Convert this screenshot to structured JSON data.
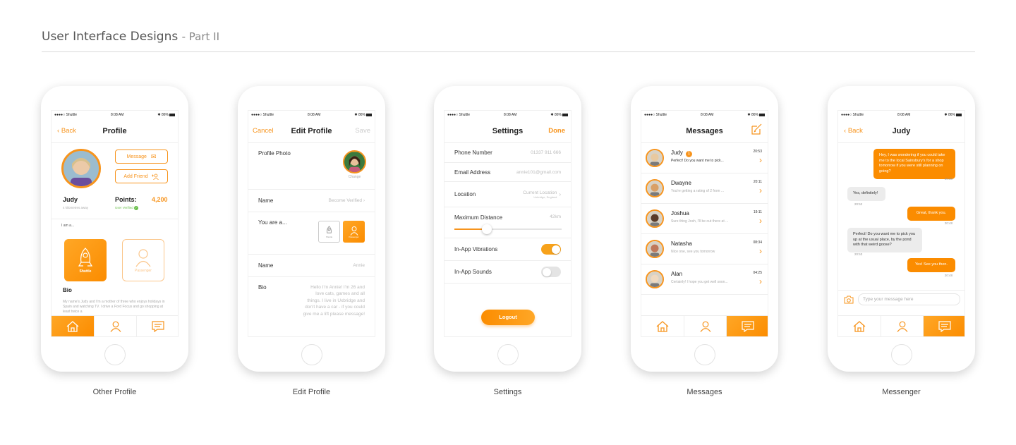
{
  "header": {
    "title": "User Interface Designs",
    "subtitle": "- Part II"
  },
  "status_bar": {
    "carrier": "●●●●○ Shuttle",
    "time": "8:08 AM",
    "battery": "✱ 86%"
  },
  "screens": {
    "other_profile": {
      "caption": "Other Profile",
      "back": "Back",
      "title": "Profile",
      "message_btn": "Message",
      "add_friend_btn": "Add Friend",
      "name": "Judy",
      "distance": "4 kilometres away",
      "points_label": "Points:",
      "points_value": "4,200",
      "verified": "User Verified",
      "role_prompt": "I am a...",
      "role_shuttle": "Shuttle",
      "role_passenger": "Passenger",
      "bio_label": "Bio",
      "bio_text": "My name's Judy and I'm a mother of three who enjoys holidays in Spain and watching TV. I drive a Ford Focus and go shopping at least twice a"
    },
    "edit_profile": {
      "caption": "Edit Profile",
      "cancel": "Cancel",
      "title": "Edit Profile",
      "save": "Save",
      "photo_label": "Profile Photo",
      "change": "Change",
      "name_label": "Name",
      "name_value": "Become Verified",
      "role_prompt": "You are a...",
      "role_shuttle": "Shuttle",
      "role_passenger": "Passenger",
      "name2_label": "Name",
      "name2_value": "Annie",
      "bio_label": "Bio",
      "bio_text": "Hello I'm Annie! I'm 26 and love cats, games and all things. I live in Uxbridge and don't have a car - if you could give me a lift please message!"
    },
    "settings": {
      "caption": "Settings",
      "title": "Settings",
      "done": "Done",
      "phone_label": "Phone Number",
      "phone_value": "01337 911 666",
      "email_label": "Email Address",
      "email_value": "annie101@gmail.com",
      "location_label": "Location",
      "location_value": "Current Location",
      "location_sub": "Uxbridge, England",
      "distance_label": "Maximum Distance",
      "distance_value": "42km",
      "distance_fraction": 0.3,
      "vibrations_label": "In-App Vibrations",
      "vibrations_on": true,
      "sounds_label": "In-App Sounds",
      "sounds_on": false,
      "logout": "Logout"
    },
    "messages": {
      "caption": "Messages",
      "title": "Messages",
      "items": [
        {
          "name": "Judy",
          "badge": "1",
          "time": "20:53",
          "preview": "Perfect! Do you want me to pick...",
          "face": "#e8c9a0"
        },
        {
          "name": "Dwayne",
          "badge": "",
          "time": "20:11",
          "preview": "You're getting a rating of 2 from ...",
          "face": "#d9a066"
        },
        {
          "name": "Joshua",
          "badge": "",
          "time": "19:11",
          "preview": "Sure thing Josh, I'll be out there at ...",
          "face": "#5a3b28"
        },
        {
          "name": "Natasha",
          "badge": "",
          "time": "08:34",
          "preview": "Nice one, see you tomorrow",
          "face": "#c0785a"
        },
        {
          "name": "Alan",
          "badge": "",
          "time": "04:25",
          "preview": "Certainly! I hope you get well soon...",
          "face": "#efd9c0"
        }
      ]
    },
    "messenger": {
      "caption": "Messenger",
      "back": "Back",
      "title": "Judy",
      "input_placeholder": "Type your message here",
      "bubbles": [
        {
          "dir": "out",
          "text": "Hey, I was wondering if you could take me to the local Sainsbury's for a shop tomorrow if you were still planning on going?",
          "time": "20:38"
        },
        {
          "dir": "in",
          "text": "Yes, definitely!",
          "time": "20:52"
        },
        {
          "dir": "out",
          "text": "Great, thank you.",
          "time": "20:48"
        },
        {
          "dir": "in",
          "text": "Perfect! Do you want me to pick you up at the usual place, by the pond with that weird goose?",
          "time": "20:53"
        },
        {
          "dir": "out",
          "text": "Yes! See you then.",
          "time": "20:48"
        }
      ]
    }
  }
}
